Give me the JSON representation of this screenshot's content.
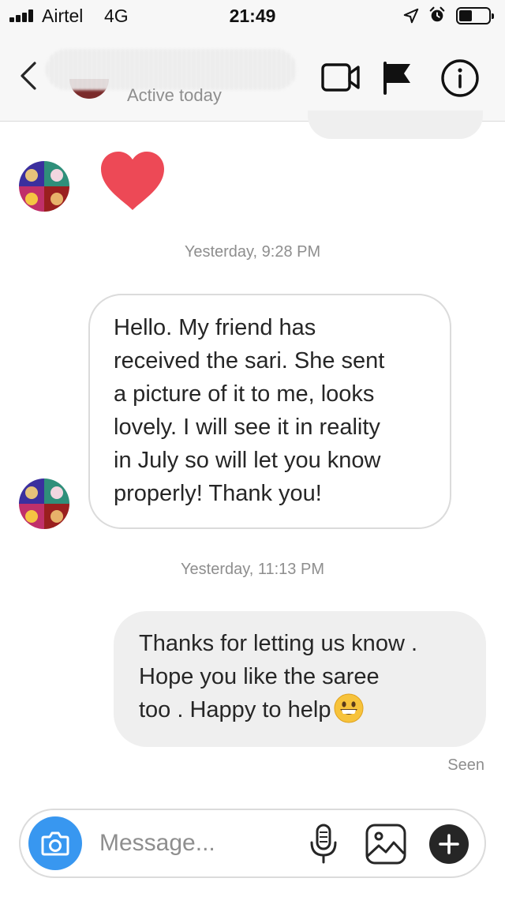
{
  "status_bar": {
    "carrier": "Airtel",
    "network": "4G",
    "time": "21:49",
    "icons": [
      "signal-icon",
      "location-icon",
      "alarm-icon",
      "battery-icon"
    ],
    "battery_level": 0.45
  },
  "header": {
    "status": "Active today",
    "actions": [
      "back-icon",
      "video-call-icon",
      "flag-icon",
      "info-icon"
    ]
  },
  "messages": [
    {
      "type": "reaction",
      "from": "other",
      "content": "heart-icon"
    },
    {
      "type": "timestamp",
      "text": "Yesterday, 9:28 PM"
    },
    {
      "type": "text",
      "from": "other",
      "text": "Hello. My friend has\nreceived the sari. She sent\na picture of it to me, looks\nlovely.  I will see it in reality\nin July so will let you know\nproperly! Thank you!"
    },
    {
      "type": "timestamp",
      "text": "Yesterday, 11:13 PM"
    },
    {
      "type": "text",
      "from": "me",
      "text": "Thanks for letting us know .\nHope you like the saree\ntoo . Happy to help",
      "emoji": "grinning-face-emoji"
    },
    {
      "type": "receipt",
      "text": "Seen"
    }
  ],
  "composer": {
    "placeholder": "Message...",
    "value": "",
    "icons": [
      "camera-icon",
      "microphone-icon",
      "gallery-icon",
      "plus-icon"
    ]
  },
  "colors": {
    "accent": "#3897f0",
    "heart": "#ed4956",
    "bubble_out": "#efefef",
    "bubble_in_border": "#dbdbdb",
    "muted_text": "#8e8e8e"
  }
}
